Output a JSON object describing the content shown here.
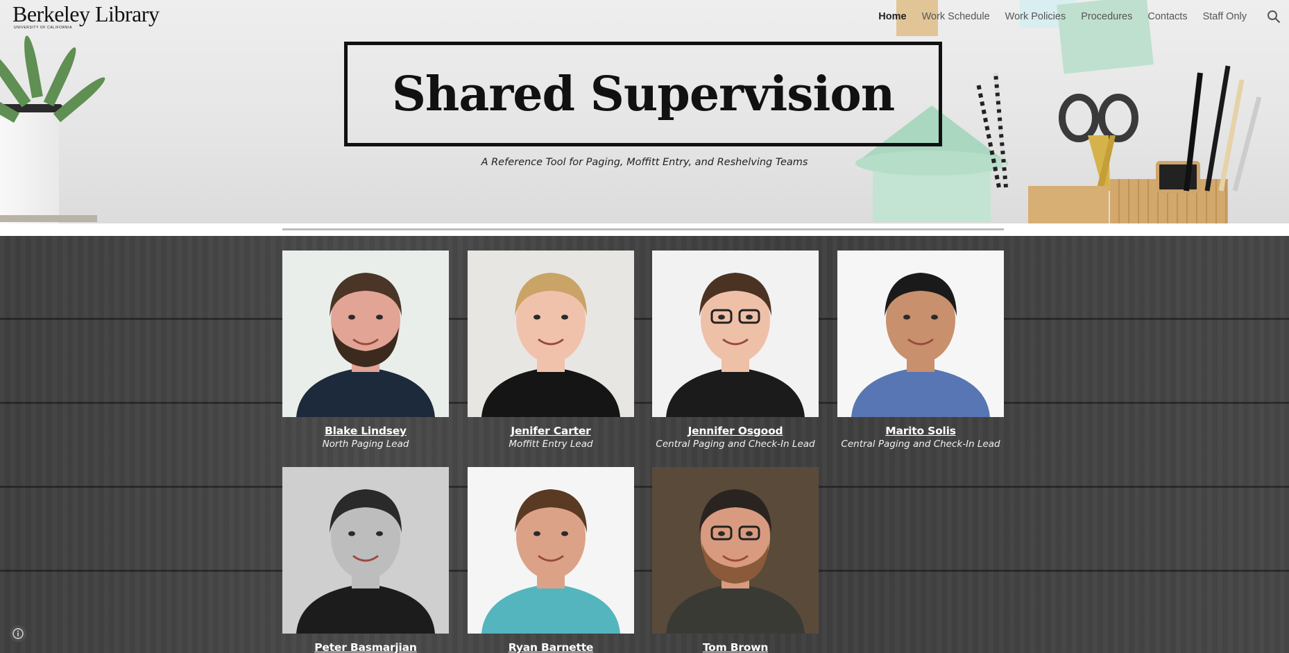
{
  "site": {
    "logo_text": "Berkeley Library",
    "logo_subtext": "UNIVERSITY OF CALIFORNIA"
  },
  "nav": {
    "items": [
      {
        "label": "Home",
        "active": true
      },
      {
        "label": "Work Schedule",
        "active": false
      },
      {
        "label": "Work Policies",
        "active": false
      },
      {
        "label": "Procedures",
        "active": false
      },
      {
        "label": "Contacts",
        "active": false
      },
      {
        "label": "Staff Only",
        "active": false
      }
    ],
    "search_icon": "search-icon"
  },
  "hero": {
    "title": "Shared Supervision",
    "subtitle": "A Reference Tool for Paging, Moffitt Entry, and Reshelving Teams"
  },
  "staff": [
    {
      "name": "Blake Lindsey",
      "role": "North Paging Lead",
      "photo": {
        "bg": "#e9eeea",
        "skin": "#e2a495",
        "hair": "#4a3527",
        "beard": "#3c2a1e",
        "shirt": "#1d2a3c",
        "glasses": false
      }
    },
    {
      "name": "Jenifer Carter",
      "role": "Moffitt Entry Lead",
      "photo": {
        "bg": "#e8e6e3",
        "skin": "#f0c2ac",
        "hair": "#c9a466",
        "beard": "",
        "shirt": "#151515",
        "glasses": false
      }
    },
    {
      "name": "Jennifer Osgood",
      "role": "Central Paging and Check-In Lead",
      "photo": {
        "bg": "#f2f2f2",
        "skin": "#efc0a8",
        "hair": "#4b3324",
        "beard": "",
        "shirt": "#1b1b1b",
        "glasses": true
      }
    },
    {
      "name": "Marito Solis",
      "role": "Central Paging and Check-In Lead",
      "photo": {
        "bg": "#f6f6f6",
        "skin": "#c8906c",
        "hair": "#1a1a1a",
        "beard": "",
        "shirt": "#5876b3",
        "glasses": false
      }
    },
    {
      "name": "Peter Basmarjian",
      "role": "",
      "photo": {
        "bg": "#cfcfcf",
        "skin": "#bdbdbd",
        "hair": "#2a2a2a",
        "beard": "",
        "shirt": "#1c1c1c",
        "glasses": false
      }
    },
    {
      "name": "Ryan Barnette",
      "role": "",
      "photo": {
        "bg": "#f5f5f5",
        "skin": "#dca287",
        "hair": "#5a3a22",
        "beard": "",
        "shirt": "#54b5be",
        "glasses": false
      }
    },
    {
      "name": "Tom Brown",
      "role": "",
      "photo": {
        "bg": "#5a4a3a",
        "skin": "#d99b80",
        "hair": "#2a2420",
        "beard": "#8a5a3a",
        "shirt": "#3a3a35",
        "glasses": true
      }
    }
  ],
  "footer": {
    "info_icon": "info-icon"
  }
}
